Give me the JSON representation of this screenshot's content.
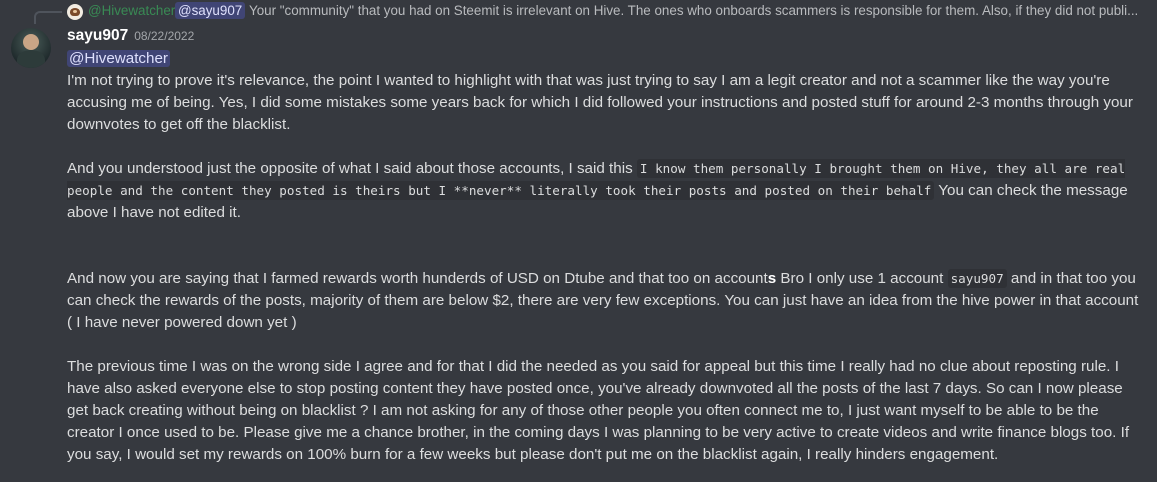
{
  "reply": {
    "author": "@Hivewatcher",
    "mention": "@sayu907",
    "text": "Your \"community\" that you had on Steemit is irrelevant on Hive. The ones who onboards scammers is responsible for them. Also, if they did not publi..."
  },
  "message": {
    "username": "sayu907",
    "timestamp": "08/22/2022",
    "mention": "@Hivewatcher",
    "p1": "I'm not trying to prove it's relevance, the point I wanted to highlight with that was just trying to say I am a legit creator and not a scammer like the way you're accusing me of being. Yes, I did some mistakes some years back for which I did followed your instructions and posted stuff for around 2-3 months through your downvotes to get off the blacklist.",
    "p2_before": "And you understood just the opposite of what I said about those accounts, I said this ",
    "p2_code": "I know them personally I brought them on Hive, they all are real people and the content they posted is theirs but I **never** literally took their posts and posted on their behalf",
    "p2_after": " You can check the message above I have not edited it.",
    "p3_before": "And now you are saying that I farmed rewards worth hunderds of USD on Dtube and that too on account",
    "p3_bold": "s",
    "p3_mid": " Bro I only use 1 account ",
    "p3_code": "sayu907",
    "p3_after": " and in that too you can check the rewards of the posts, majority of them are below $2, there are very few exceptions. You can just have an idea from the hive power in that account ( I have never powered down yet )",
    "p4": "The previous time I was on the wrong side I agree and for that I did the needed as you said for appeal but this time I really had no clue about reposting rule. I have also asked everyone else to stop posting content they have posted once, you've already downvoted all the posts of the last 7 days. So can I now please get back creating without being on blacklist ? I am not asking for any of those other people you often connect me to, I just want myself to be able to be the creator I once used to be. Please give me a chance brother, in the coming days I was planning to be very active to create videos and write finance blogs too. If you say, I would set my rewards on 100% burn for a few weeks but please don't put me on the blacklist again, I really hinders engagement."
  }
}
